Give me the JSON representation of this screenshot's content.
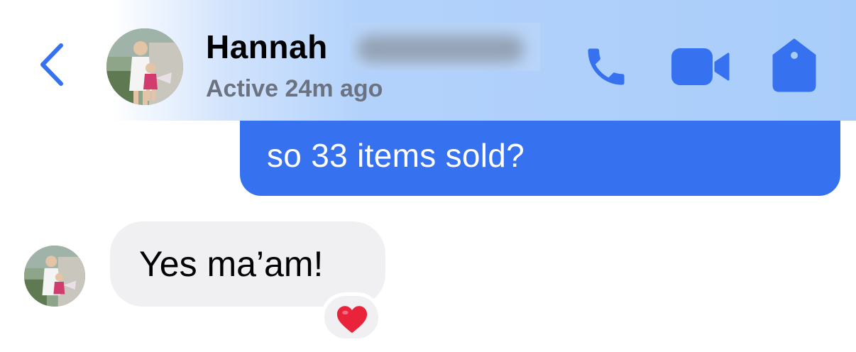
{
  "header": {
    "back_icon": "chevron-left-icon",
    "contact_name": "Hannah",
    "name_redacted": true,
    "status": "Active 24m ago",
    "actions": [
      {
        "icon": "phone-icon"
      },
      {
        "icon": "video-camera-icon"
      },
      {
        "icon": "tag-icon"
      }
    ],
    "accent_color": "#3671f0"
  },
  "messages": [
    {
      "direction": "sent",
      "text": "so 33 items sold?"
    },
    {
      "direction": "received",
      "text": "Yes ma’am!",
      "reaction": "❤️"
    }
  ],
  "colors": {
    "sent_bubble": "#3671f0",
    "received_bubble": "#f0f0f3",
    "status_text": "#6b7280",
    "heart": "#e8233a"
  }
}
